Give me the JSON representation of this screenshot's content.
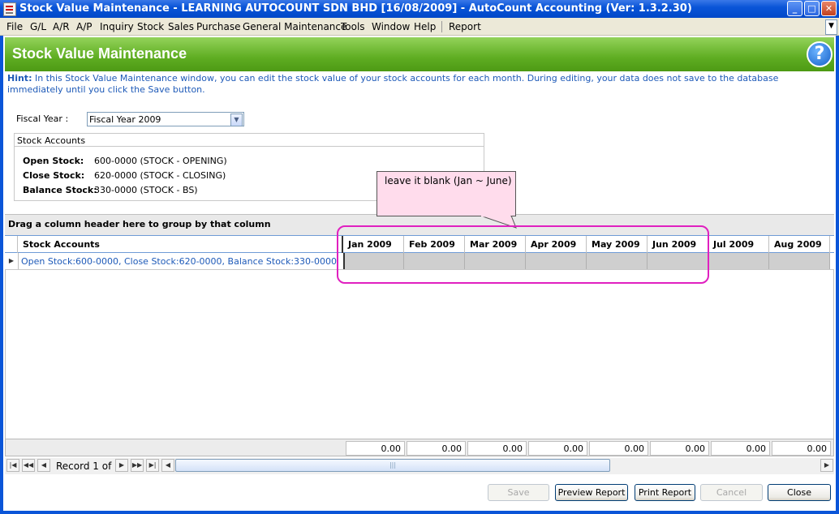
{
  "window": {
    "title": "Stock Value Maintenance - LEARNING AUTOCOUNT SDN BHD [16/08/2009] - AutoCount Accounting (Ver: 1.3.2.30)",
    "minimize_icon": "minimize-icon",
    "maximize_icon": "maximize-icon",
    "close_icon": "close-icon"
  },
  "menu": [
    "File",
    "G/L",
    "A/R",
    "A/P",
    "Inquiry",
    "Stock",
    "Sales",
    "Purchase",
    "General Maintenance",
    "Tools",
    "Window",
    "Help",
    "Report"
  ],
  "header": {
    "title": "Stock Value Maintenance",
    "help_label": "?"
  },
  "hint": {
    "label": "Hint:",
    "text": "In this Stock Value Maintenance window, you can edit the stock value of your stock accounts for each month. During editing, your data does not save to the database immediately until you click the Save button."
  },
  "fiscal_year": {
    "label": "Fiscal Year :",
    "value": "Fiscal Year 2009"
  },
  "stock_accounts": {
    "legend": "Stock Accounts",
    "rows": [
      {
        "label": "Open Stock:",
        "value": "600-0000  (STOCK - OPENING)"
      },
      {
        "label": "Close Stock:",
        "value": "620-0000  (STOCK - CLOSING)"
      },
      {
        "label": "Balance Stock:",
        "value": "330-0000  (STOCK - BS)"
      }
    ]
  },
  "callout": {
    "text": "leave it blank (Jan ~ June)"
  },
  "grid": {
    "group_hint": "Drag a column header here to group by that column",
    "first_column": "Stock Accounts",
    "months": [
      "Jan 2009",
      "Feb 2009",
      "Mar 2009",
      "Apr 2009",
      "May 2009",
      "Jun 2009",
      "Jul 2009",
      "Aug 2009"
    ],
    "row_text": "Open Stock:600-0000, Close Stock:620-0000, Balance Stock:330-0000",
    "totals": [
      "0.00",
      "0.00",
      "0.00",
      "0.00",
      "0.00",
      "0.00",
      "0.00",
      "0.00"
    ]
  },
  "navigator": {
    "record_text": "Record 1 of 1"
  },
  "buttons": {
    "save": "Save",
    "preview": "Preview Report",
    "print": "Print Report",
    "cancel": "Cancel",
    "close": "Close"
  },
  "colors": {
    "accent_green": "#5fad22",
    "highlight": "#e020c0",
    "title_blue": "#0a55d8",
    "link_blue": "#1e5ab8"
  }
}
